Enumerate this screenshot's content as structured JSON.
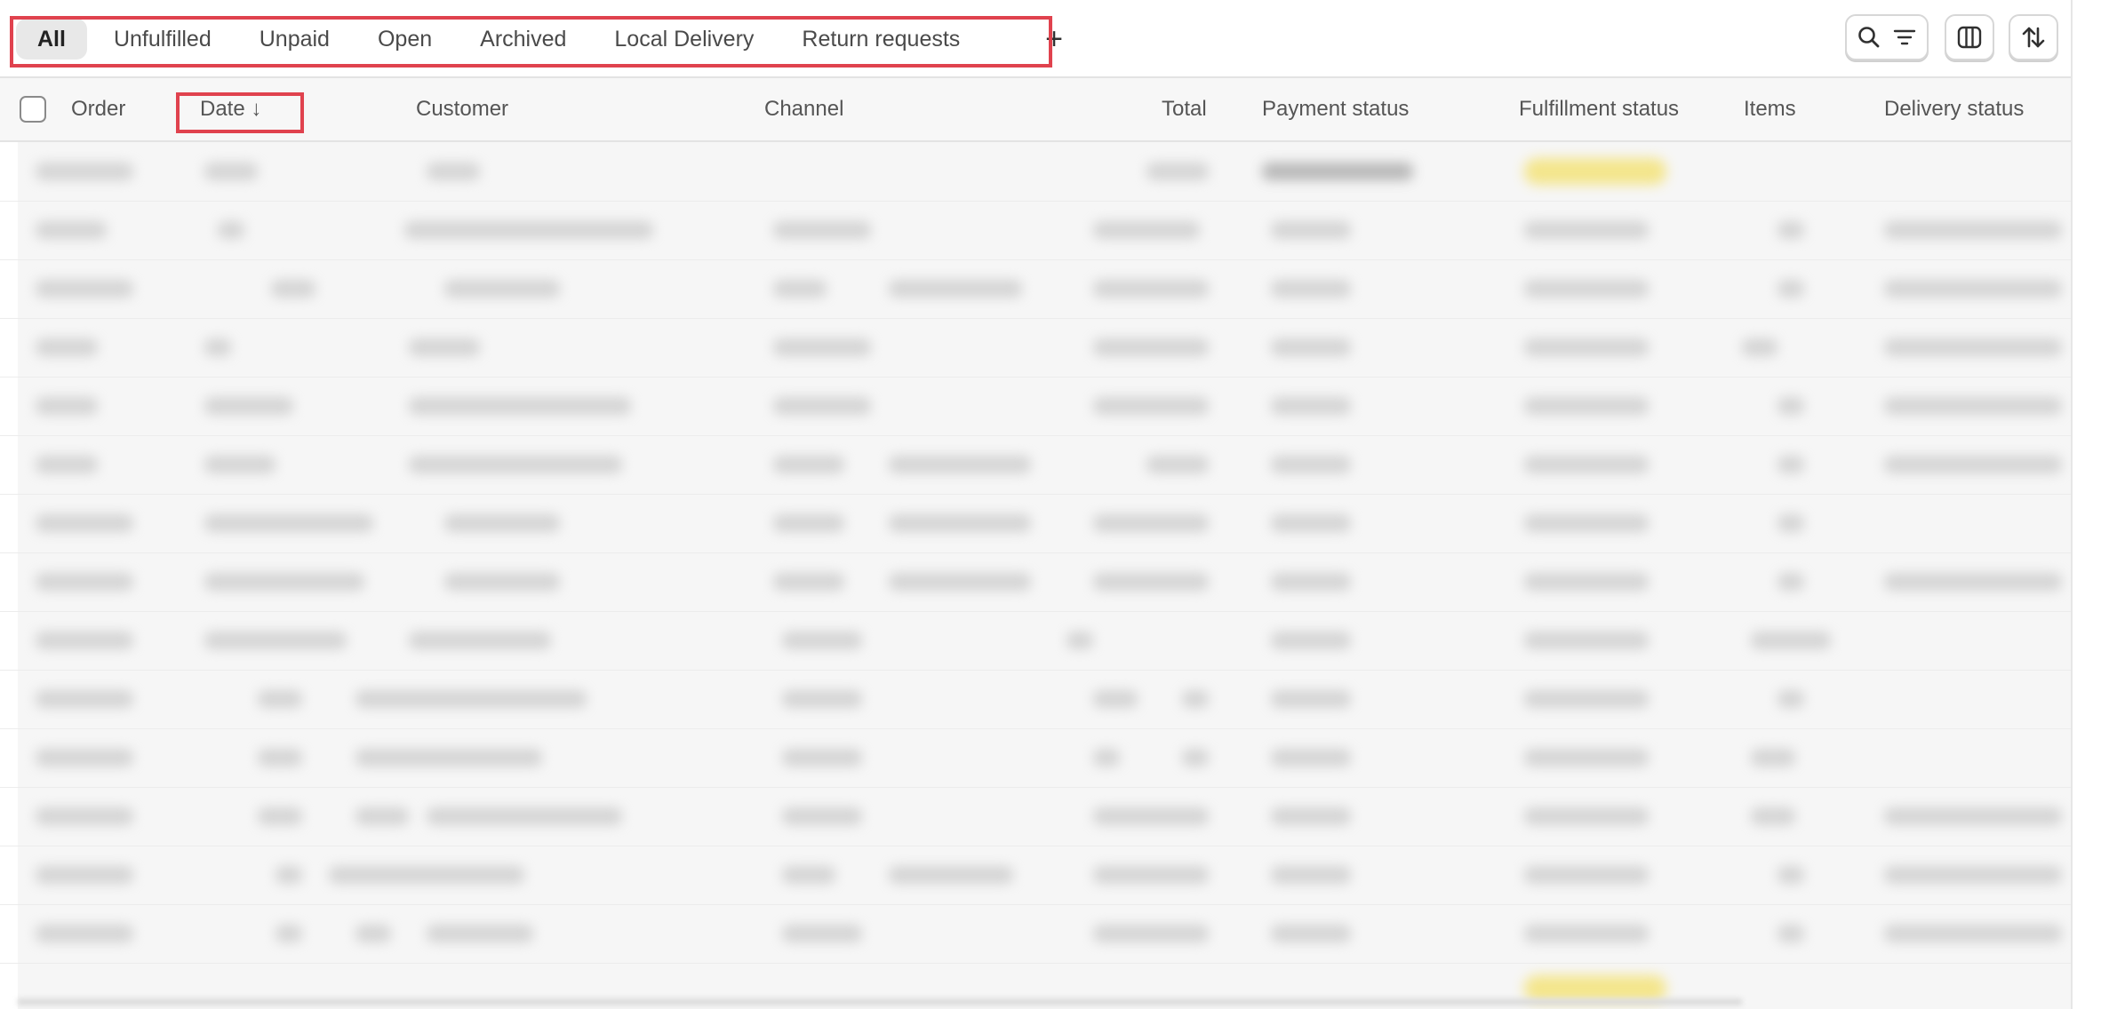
{
  "tabs": [
    {
      "label": "All",
      "active": true
    },
    {
      "label": "Unfulfilled",
      "active": false
    },
    {
      "label": "Unpaid",
      "active": false
    },
    {
      "label": "Open",
      "active": false
    },
    {
      "label": "Archived",
      "active": false
    },
    {
      "label": "Local Delivery",
      "active": false
    },
    {
      "label": "Return requests",
      "active": false
    }
  ],
  "add_tab_label": "+",
  "toolbar": {
    "search_filter_icon": "search-filter-icon",
    "columns_icon": "columns-icon",
    "sort_icon": "sort-icon"
  },
  "columns": {
    "order": "Order",
    "date": "Date ↓",
    "customer": "Customer",
    "channel": "Channel",
    "total": "Total",
    "payment_status": "Payment status",
    "fulfillment_status": "Fulfillment status",
    "items": "Items",
    "delivery_status": "Delivery status"
  },
  "colors": {
    "highlight": "#e0424e",
    "active_tab_bg": "#e8e8e8",
    "fulfillment_badge": "#f4e37a"
  }
}
